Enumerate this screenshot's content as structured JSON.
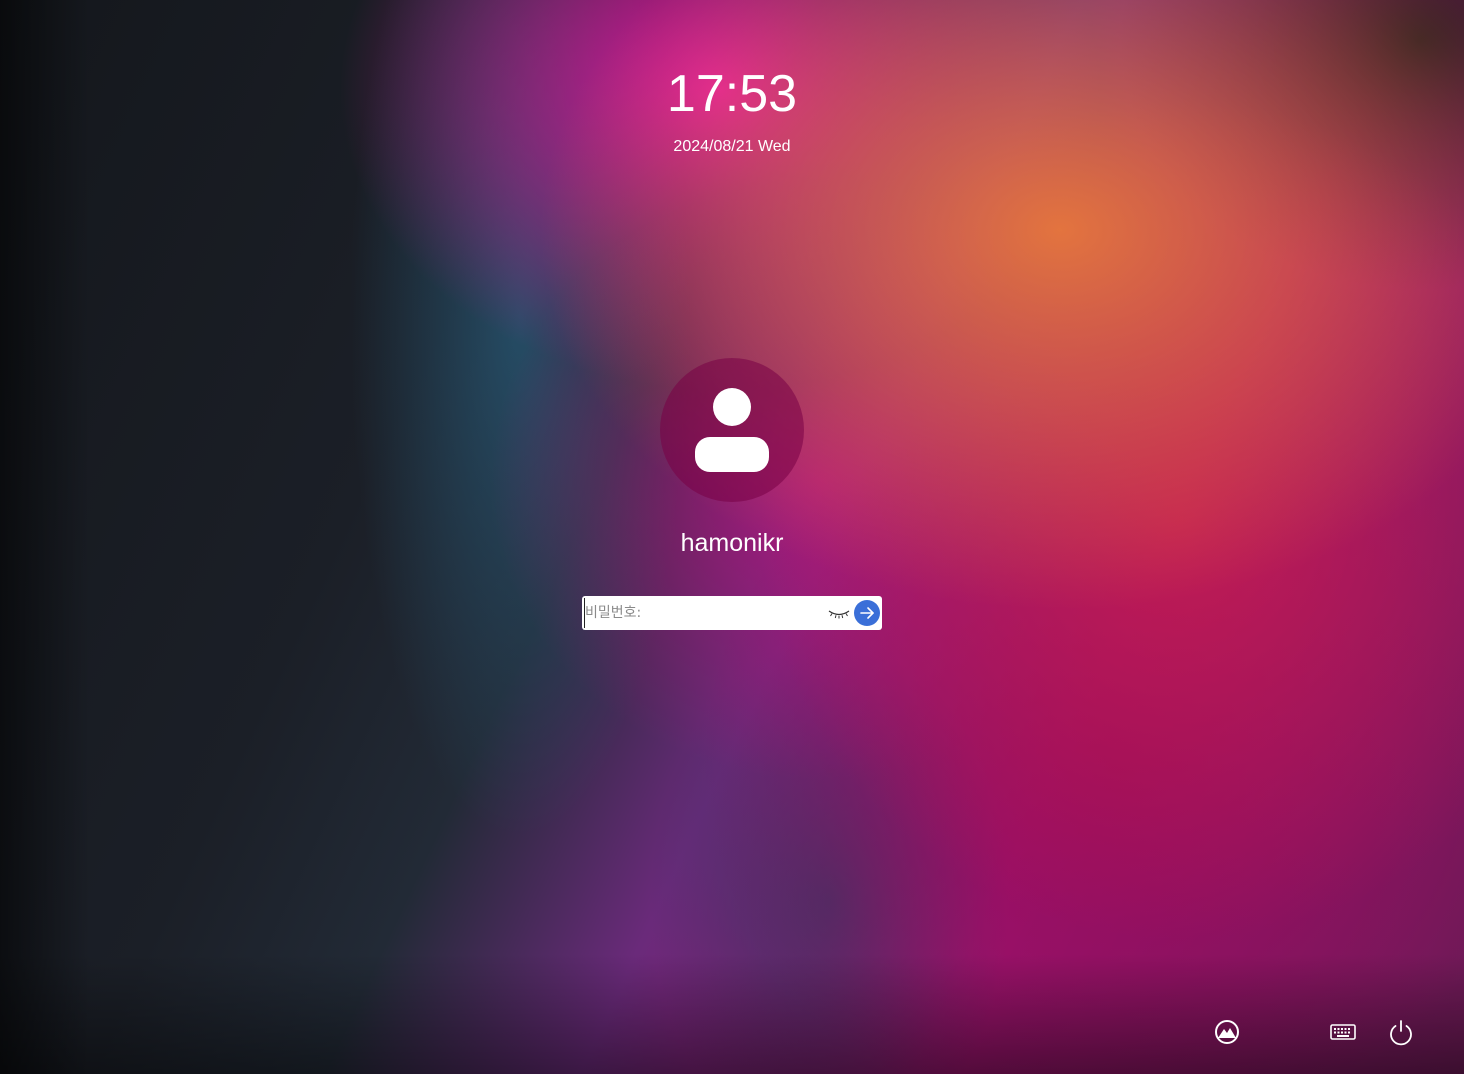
{
  "lock_screen": {
    "time": "17:53",
    "date": "2024/08/21 Wed"
  },
  "user": {
    "name": "hamonikr",
    "avatar_icon": "user-silhouette-icon",
    "avatar_bg": "#7a0046"
  },
  "password": {
    "placeholder": "비밀번호:",
    "value": "",
    "reveal_icon": "eye-closed-icon",
    "submit_icon": "arrow-right-icon",
    "submit_color": "#3a6fd8"
  },
  "tray": {
    "session_icon": "session-mountain-icon",
    "keyboard_icon": "keyboard-icon",
    "power_icon": "power-icon"
  }
}
